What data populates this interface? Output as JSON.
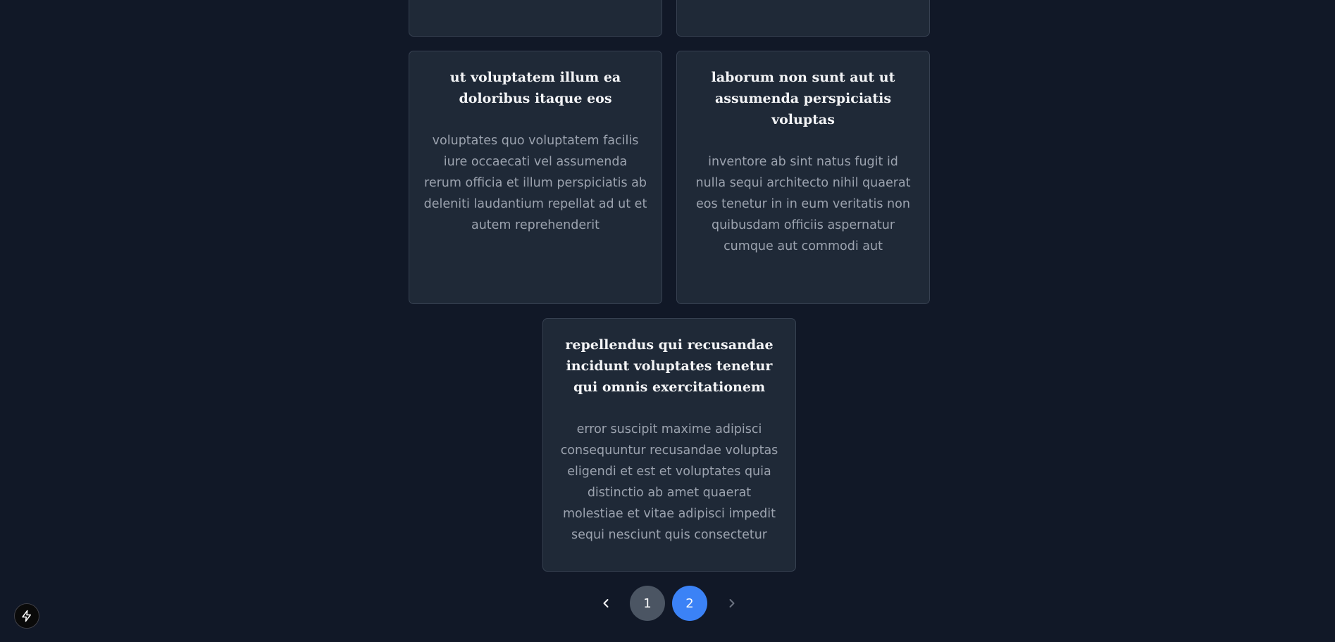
{
  "posts": [
    {
      "title": "ut voluptatem illum ea doloribus itaque eos",
      "body": "voluptates quo voluptatem facilis iure occaecati vel assumenda rerum officia et illum perspiciatis ab deleniti laudantium repellat ad ut et autem reprehenderit"
    },
    {
      "title": "laborum non sunt aut ut assumenda perspiciatis voluptas",
      "body": "inventore ab sint natus fugit id nulla sequi architecto nihil quaerat eos tenetur in in eum veritatis non quibusdam officiis aspernatur cumque aut commodi aut"
    },
    {
      "title": "repellendus qui recusandae incidunt voluptates tenetur qui omnis exercitationem",
      "body": "error suscipit maxime adipisci consequuntur recusandae voluptas eligendi et est et voluptates quia distinctio ab amet quaerat molestiae et vitae adipisci impedit sequi nesciunt quis consectetur"
    }
  ],
  "pagination": {
    "pages": [
      "1",
      "2"
    ],
    "current_page": "2",
    "prev_icon": "chevron-left-icon",
    "next_icon": "chevron-right-icon"
  },
  "dev_badge": {
    "icon": "lightning-bolt-icon"
  },
  "colors": {
    "background": "#111827",
    "card": "#1f2937",
    "card_border": "#374151",
    "title": "#f3f4f6",
    "body_text": "#9ca3af",
    "page_inactive": "#4b5563",
    "page_active": "#3b82f6"
  }
}
